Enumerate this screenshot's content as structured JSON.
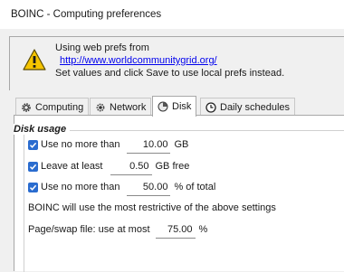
{
  "window": {
    "title": "BOINC - Computing preferences"
  },
  "info": {
    "line1": "Using web prefs from",
    "url": "http://www.worldcommunitygrid.org/",
    "line3": "Set values and click Save to use local prefs instead."
  },
  "tabs": [
    {
      "label": "Computing",
      "icon": "gear-icon"
    },
    {
      "label": "Network",
      "icon": "network-icon"
    },
    {
      "label": "Disk",
      "icon": "disk-icon",
      "active": true
    },
    {
      "label": "Daily schedules",
      "icon": "clock-icon"
    }
  ],
  "disk": {
    "group_title": "Disk usage",
    "use_max": {
      "checked": true,
      "label": "Use no more than",
      "value": "10.00",
      "unit": "GB"
    },
    "leave_at_least": {
      "checked": true,
      "label": "Leave at least",
      "value": "0.50",
      "unit": "GB free"
    },
    "use_max_percent": {
      "checked": true,
      "label": "Use no more than",
      "value": "50.00",
      "unit": "% of total"
    },
    "note": "BOINC will use the most restrictive of the above settings",
    "page_swap": {
      "label": "Page/swap file: use at most",
      "value": "75.00",
      "unit": "%"
    }
  },
  "colors": {
    "checkbox": "#2a6ccf",
    "link": "#0000ee",
    "warning": "#f5c400"
  }
}
